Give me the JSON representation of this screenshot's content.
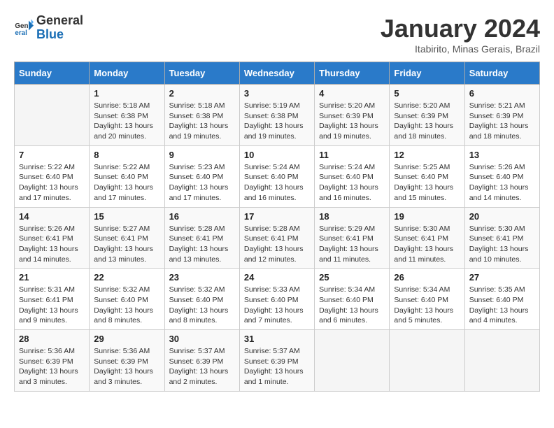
{
  "header": {
    "logo_general": "General",
    "logo_blue": "Blue",
    "month_year": "January 2024",
    "location": "Itabirito, Minas Gerais, Brazil"
  },
  "weekdays": [
    "Sunday",
    "Monday",
    "Tuesday",
    "Wednesday",
    "Thursday",
    "Friday",
    "Saturday"
  ],
  "weeks": [
    [
      {
        "day": "",
        "info": ""
      },
      {
        "day": "1",
        "info": "Sunrise: 5:18 AM\nSunset: 6:38 PM\nDaylight: 13 hours\nand 20 minutes."
      },
      {
        "day": "2",
        "info": "Sunrise: 5:18 AM\nSunset: 6:38 PM\nDaylight: 13 hours\nand 19 minutes."
      },
      {
        "day": "3",
        "info": "Sunrise: 5:19 AM\nSunset: 6:38 PM\nDaylight: 13 hours\nand 19 minutes."
      },
      {
        "day": "4",
        "info": "Sunrise: 5:20 AM\nSunset: 6:39 PM\nDaylight: 13 hours\nand 19 minutes."
      },
      {
        "day": "5",
        "info": "Sunrise: 5:20 AM\nSunset: 6:39 PM\nDaylight: 13 hours\nand 18 minutes."
      },
      {
        "day": "6",
        "info": "Sunrise: 5:21 AM\nSunset: 6:39 PM\nDaylight: 13 hours\nand 18 minutes."
      }
    ],
    [
      {
        "day": "7",
        "info": "Sunrise: 5:22 AM\nSunset: 6:40 PM\nDaylight: 13 hours\nand 17 minutes."
      },
      {
        "day": "8",
        "info": "Sunrise: 5:22 AM\nSunset: 6:40 PM\nDaylight: 13 hours\nand 17 minutes."
      },
      {
        "day": "9",
        "info": "Sunrise: 5:23 AM\nSunset: 6:40 PM\nDaylight: 13 hours\nand 17 minutes."
      },
      {
        "day": "10",
        "info": "Sunrise: 5:24 AM\nSunset: 6:40 PM\nDaylight: 13 hours\nand 16 minutes."
      },
      {
        "day": "11",
        "info": "Sunrise: 5:24 AM\nSunset: 6:40 PM\nDaylight: 13 hours\nand 16 minutes."
      },
      {
        "day": "12",
        "info": "Sunrise: 5:25 AM\nSunset: 6:40 PM\nDaylight: 13 hours\nand 15 minutes."
      },
      {
        "day": "13",
        "info": "Sunrise: 5:26 AM\nSunset: 6:40 PM\nDaylight: 13 hours\nand 14 minutes."
      }
    ],
    [
      {
        "day": "14",
        "info": "Sunrise: 5:26 AM\nSunset: 6:41 PM\nDaylight: 13 hours\nand 14 minutes."
      },
      {
        "day": "15",
        "info": "Sunrise: 5:27 AM\nSunset: 6:41 PM\nDaylight: 13 hours\nand 13 minutes."
      },
      {
        "day": "16",
        "info": "Sunrise: 5:28 AM\nSunset: 6:41 PM\nDaylight: 13 hours\nand 13 minutes."
      },
      {
        "day": "17",
        "info": "Sunrise: 5:28 AM\nSunset: 6:41 PM\nDaylight: 13 hours\nand 12 minutes."
      },
      {
        "day": "18",
        "info": "Sunrise: 5:29 AM\nSunset: 6:41 PM\nDaylight: 13 hours\nand 11 minutes."
      },
      {
        "day": "19",
        "info": "Sunrise: 5:30 AM\nSunset: 6:41 PM\nDaylight: 13 hours\nand 11 minutes."
      },
      {
        "day": "20",
        "info": "Sunrise: 5:30 AM\nSunset: 6:41 PM\nDaylight: 13 hours\nand 10 minutes."
      }
    ],
    [
      {
        "day": "21",
        "info": "Sunrise: 5:31 AM\nSunset: 6:41 PM\nDaylight: 13 hours\nand 9 minutes."
      },
      {
        "day": "22",
        "info": "Sunrise: 5:32 AM\nSunset: 6:40 PM\nDaylight: 13 hours\nand 8 minutes."
      },
      {
        "day": "23",
        "info": "Sunrise: 5:32 AM\nSunset: 6:40 PM\nDaylight: 13 hours\nand 8 minutes."
      },
      {
        "day": "24",
        "info": "Sunrise: 5:33 AM\nSunset: 6:40 PM\nDaylight: 13 hours\nand 7 minutes."
      },
      {
        "day": "25",
        "info": "Sunrise: 5:34 AM\nSunset: 6:40 PM\nDaylight: 13 hours\nand 6 minutes."
      },
      {
        "day": "26",
        "info": "Sunrise: 5:34 AM\nSunset: 6:40 PM\nDaylight: 13 hours\nand 5 minutes."
      },
      {
        "day": "27",
        "info": "Sunrise: 5:35 AM\nSunset: 6:40 PM\nDaylight: 13 hours\nand 4 minutes."
      }
    ],
    [
      {
        "day": "28",
        "info": "Sunrise: 5:36 AM\nSunset: 6:39 PM\nDaylight: 13 hours\nand 3 minutes."
      },
      {
        "day": "29",
        "info": "Sunrise: 5:36 AM\nSunset: 6:39 PM\nDaylight: 13 hours\nand 3 minutes."
      },
      {
        "day": "30",
        "info": "Sunrise: 5:37 AM\nSunset: 6:39 PM\nDaylight: 13 hours\nand 2 minutes."
      },
      {
        "day": "31",
        "info": "Sunrise: 5:37 AM\nSunset: 6:39 PM\nDaylight: 13 hours\nand 1 minute."
      },
      {
        "day": "",
        "info": ""
      },
      {
        "day": "",
        "info": ""
      },
      {
        "day": "",
        "info": ""
      }
    ]
  ]
}
